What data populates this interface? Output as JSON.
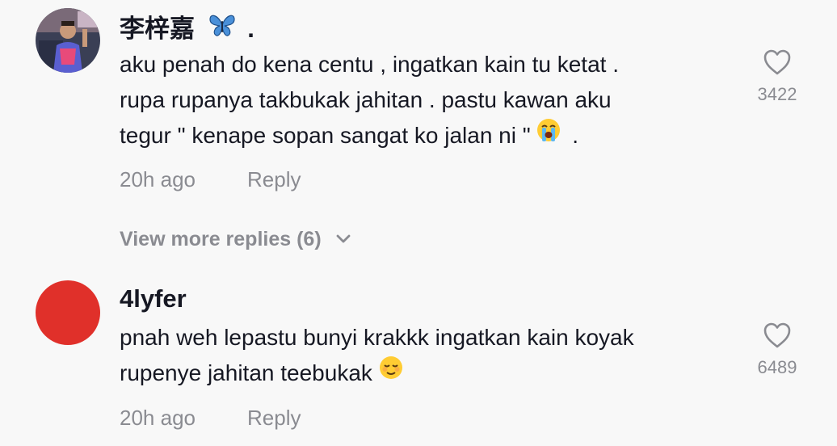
{
  "comments": [
    {
      "username": "李梓嘉",
      "username_suffix": ".",
      "text_lines": [
        "aku penah do kena centu , ingatkan kain tu ketat .",
        "rupa rupanya takbukak jahitan . pastu kawan aku",
        "tegur \" kenape sopan sangat ko jalan ni \"",
        "."
      ],
      "emoji": "loudly-crying-face",
      "time": "20h ago",
      "reply_label": "Reply",
      "likes": "3422",
      "badge_icon": "butterfly-icon"
    },
    {
      "username": "4lyfer",
      "text_lines": [
        "pnah weh lepastu bunyi krakkk ingatkan kain koyak",
        "rupenye jahitan teebukak"
      ],
      "emoji": "relieved-face",
      "time": "20h ago",
      "reply_label": "Reply",
      "likes": "6489",
      "avatar_color": "#e0302a"
    }
  ],
  "view_more_replies": "View more replies (6)",
  "colors": {
    "background": "#f8f8f8",
    "text_primary": "#161823",
    "text_secondary": "#8a8b91",
    "avatar_red": "#e0302a",
    "butterfly_blue": "#4a90d9"
  }
}
